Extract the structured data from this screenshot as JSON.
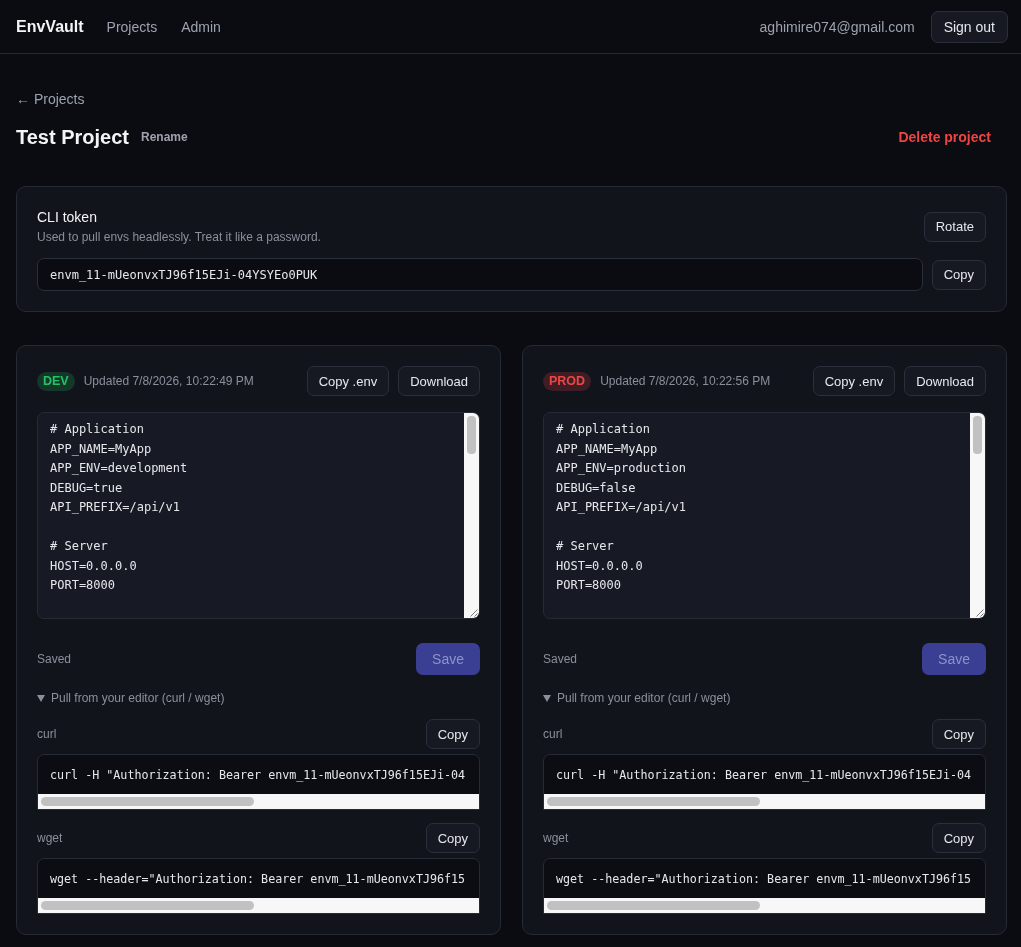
{
  "nav": {
    "brand": "EnvVault",
    "links": [
      {
        "label": "Projects"
      },
      {
        "label": "Admin"
      }
    ],
    "user_email": "aghimire074@gmail.com",
    "sign_out": "Sign out"
  },
  "header": {
    "back_link": "← Projects",
    "title": "Test Project",
    "rename": "Rename",
    "delete": "Delete project"
  },
  "cli_token": {
    "title": "CLI token",
    "description": "Used to pull envs headlessly. Treat it like a password.",
    "rotate": "Rotate",
    "token": "envm_11-mUeonvxTJ96f15EJi-04YSYEo0PUK",
    "copy": "Copy"
  },
  "environments": [
    {
      "badge": "DEV",
      "color": "#15372a",
      "updated": "Updated 7/8/2026, 10:22:49 PM",
      "copy_env": "Copy .env",
      "download": "Download",
      "content": "# Application\nAPP_NAME=MyApp\nAPP_ENV=development\nDEBUG=true\nAPI_PREFIX=/api/v1\n\n# Server\nHOST=0.0.0.0\nPORT=8000",
      "status": "Saved",
      "save": {
        "label": "Save",
        "disabled": true
      },
      "pull": {
        "summary": "Pull from your editor (curl / wget)",
        "expanded": true,
        "commands": [
          {
            "label": "curl",
            "copy": "Copy",
            "command": "curl -H \"Authorization: Bearer envm_11-mUeonvxTJ96f15EJi-04"
          },
          {
            "label": "wget",
            "copy": "Copy",
            "command": "wget --header=\"Authorization: Bearer envm_11-mUeonvxTJ96f15"
          }
        ]
      }
    },
    {
      "badge": "PROD",
      "color": "#3e1e24",
      "updated": "Updated 7/8/2026, 10:22:56 PM",
      "copy_env": "Copy .env",
      "download": "Download",
      "content": "# Application\nAPP_NAME=MyApp\nAPP_ENV=production\nDEBUG=false\nAPI_PREFIX=/api/v1\n\n# Server\nHOST=0.0.0.0\nPORT=8000",
      "status": "Saved",
      "save": {
        "label": "Save",
        "disabled": true
      },
      "pull": {
        "summary": "Pull from your editor (curl / wget)",
        "expanded": true,
        "commands": [
          {
            "label": "curl",
            "copy": "Copy",
            "command": "curl -H \"Authorization: Bearer envm_11-mUeonvxTJ96f15EJi-04"
          },
          {
            "label": "wget",
            "copy": "Copy",
            "command": "wget --header=\"Authorization: Bearer envm_11-mUeonvxTJ96f15"
          }
        ]
      }
    }
  ]
}
